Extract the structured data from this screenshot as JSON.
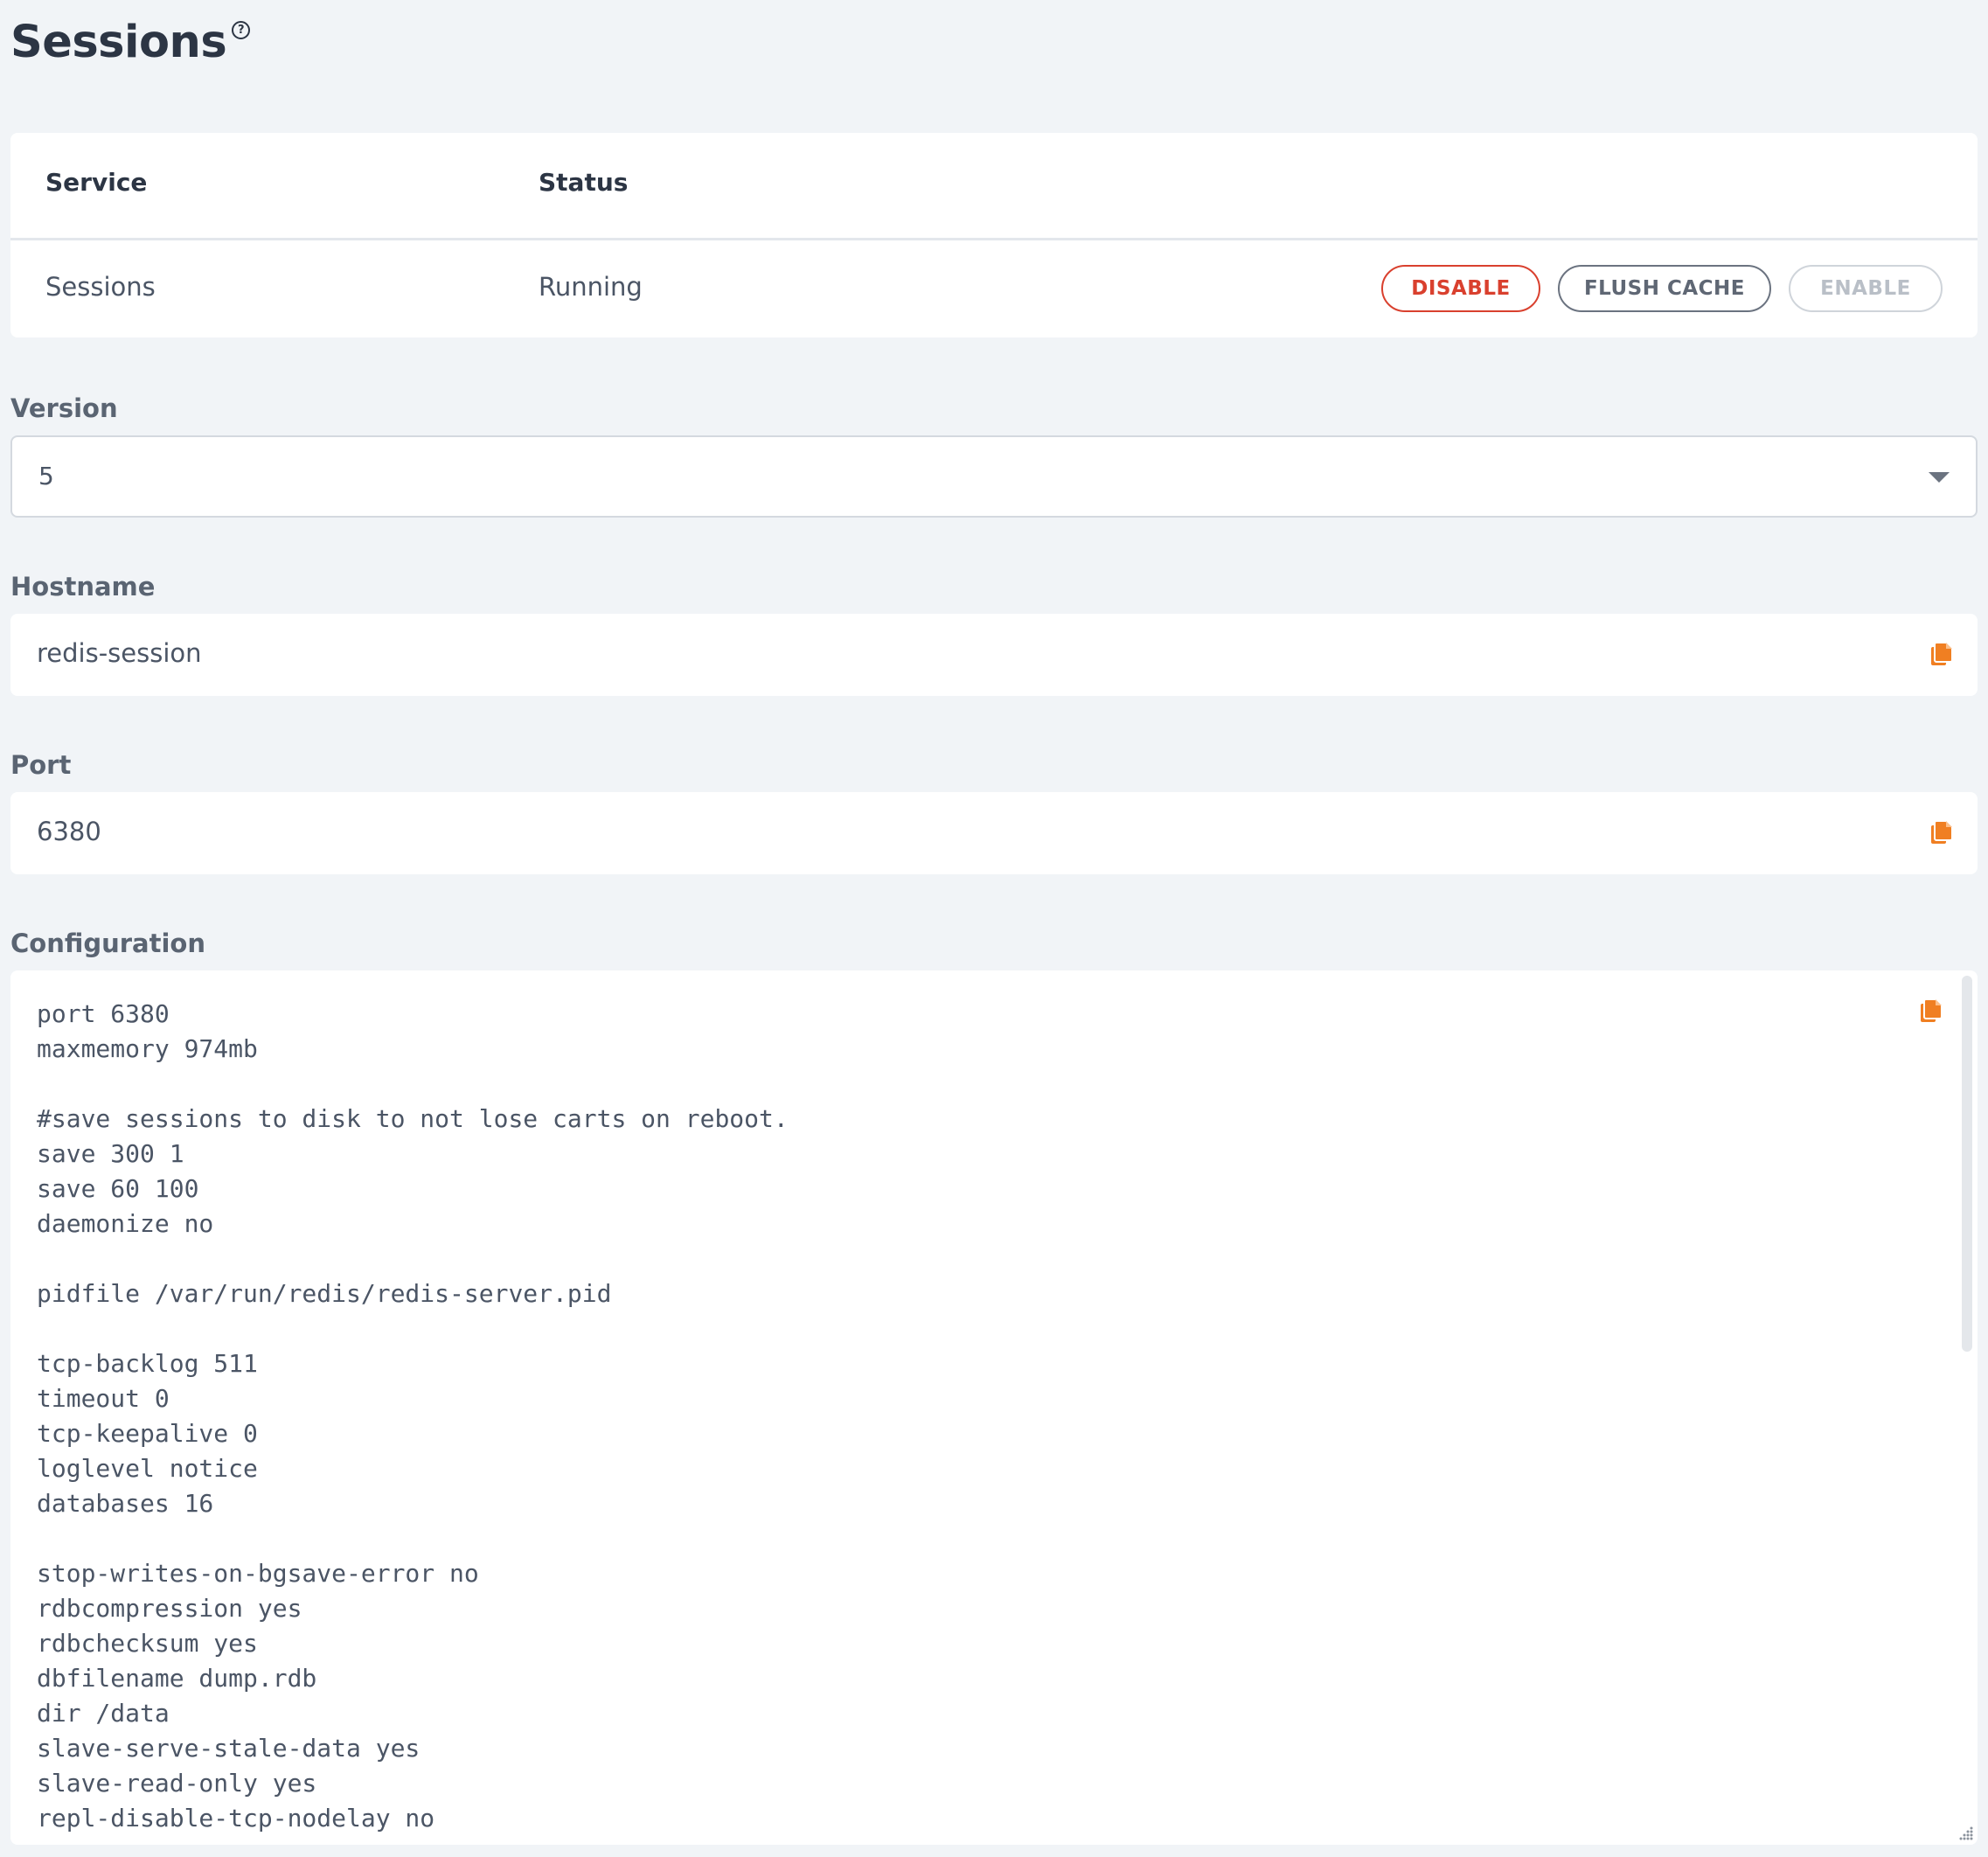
{
  "page": {
    "title": "Sessions",
    "help_icon": "help-circle-icon",
    "help_glyph": "?"
  },
  "service_table": {
    "headers": {
      "service": "Service",
      "status": "Status"
    },
    "row": {
      "service": "Sessions",
      "status": "Running"
    },
    "actions": {
      "disable": "DISABLE",
      "flush_cache": "FLUSH CACHE",
      "enable": "ENABLE"
    }
  },
  "version": {
    "label": "Version",
    "selected": "5"
  },
  "hostname": {
    "label": "Hostname",
    "value": "redis-session"
  },
  "port": {
    "label": "Port",
    "value": "6380"
  },
  "configuration": {
    "label": "Configuration",
    "lines": [
      "port 6380",
      "maxmemory 974mb",
      "",
      "#save sessions to disk to not lose carts on reboot.",
      "save 300 1",
      "save 60 100",
      "daemonize no",
      "",
      "pidfile /var/run/redis/redis-server.pid",
      "",
      "tcp-backlog 511",
      "timeout 0",
      "tcp-keepalive 0",
      "loglevel notice",
      "databases 16",
      "",
      "stop-writes-on-bgsave-error no",
      "rdbcompression yes",
      "rdbchecksum yes",
      "dbfilename dump.rdb",
      "dir /data",
      "slave-serve-stale-data yes",
      "slave-read-only yes",
      "repl-disable-tcp-nodelay no"
    ]
  },
  "colors": {
    "accent_copy": "#f07f22",
    "danger": "#d9402e",
    "background": "#f1f4f7"
  },
  "icons": {
    "copy": "copy-icon",
    "dropdown": "chevron-down-icon",
    "resize": "resize-handle-icon"
  }
}
